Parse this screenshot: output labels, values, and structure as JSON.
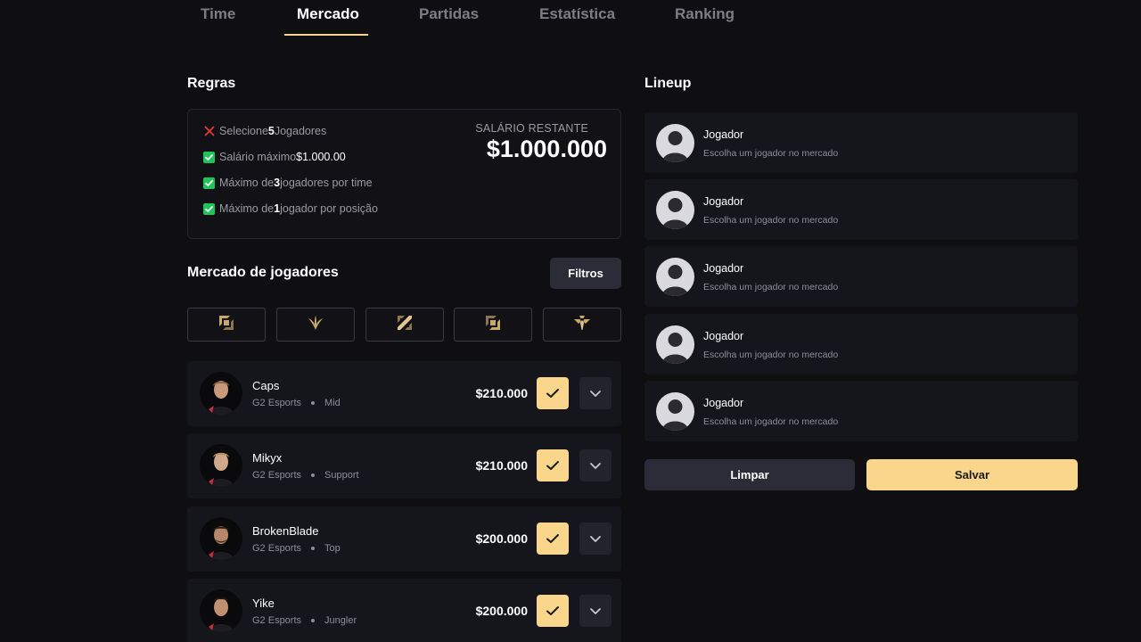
{
  "tabs": [
    {
      "label": "Time",
      "active": false
    },
    {
      "label": "Mercado",
      "active": true
    },
    {
      "label": "Partidas",
      "active": false
    },
    {
      "label": "Estatística",
      "active": false
    },
    {
      "label": "Ranking",
      "active": false
    }
  ],
  "rules": {
    "title": "Regras",
    "items": [
      {
        "status": "fail",
        "pre": "Selecione ",
        "value": "5",
        "post": " Jogadores"
      },
      {
        "status": "ok",
        "pre": "Salário máximo",
        "value": "$1.000.00",
        "post": ""
      },
      {
        "status": "ok",
        "pre": "Máximo de ",
        "value": "3",
        "post": " jogadores por time"
      },
      {
        "status": "ok",
        "pre": "Máximo de ",
        "value": "1",
        "post": " jogador por posição"
      }
    ],
    "salary_label": "SALÁRIO RESTANTE",
    "salary_value": "$1.000.000"
  },
  "market": {
    "title": "Mercado de jogadores",
    "filters_label": "Filtros",
    "roles": [
      "top-role-icon",
      "jungle-role-icon",
      "mid-role-icon",
      "bot-role-icon",
      "support-role-icon"
    ],
    "players": [
      {
        "name": "Caps",
        "team": "G2 Esports",
        "position": "Mid",
        "price": "$210.000"
      },
      {
        "name": "Mikyx",
        "team": "G2 Esports",
        "position": "Support",
        "price": "$210.000"
      },
      {
        "name": "BrokenBlade",
        "team": "G2 Esports",
        "position": "Top",
        "price": "$200.000"
      },
      {
        "name": "Yike",
        "team": "G2 Esports",
        "position": "Jungler",
        "price": "$200.000"
      }
    ]
  },
  "lineup": {
    "title": "Lineup",
    "slots": [
      {
        "title": "Jogador",
        "subtitle": "Escolha um jogador no mercado"
      },
      {
        "title": "Jogador",
        "subtitle": "Escolha um jogador no mercado"
      },
      {
        "title": "Jogador",
        "subtitle": "Escolha um jogador no mercado"
      },
      {
        "title": "Jogador",
        "subtitle": "Escolha um jogador no mercado"
      },
      {
        "title": "Jogador",
        "subtitle": "Escolha um jogador no mercado"
      }
    ],
    "clear_label": "Limpar",
    "save_label": "Salvar"
  },
  "colors": {
    "accent": "#f9d68c",
    "background": "#0f0f11",
    "card": "#15151c",
    "check": "#21c45a",
    "cross": "#e53935"
  }
}
